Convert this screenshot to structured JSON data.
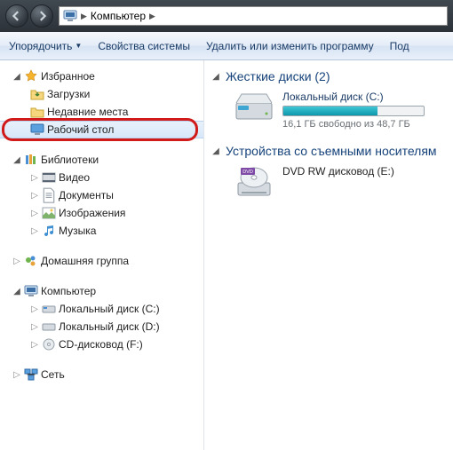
{
  "breadcrumb": {
    "root": "Компьютер"
  },
  "toolbar": {
    "organize": "Упорядочить",
    "properties": "Свойства системы",
    "uninstall": "Удалить или изменить программу",
    "connect": "Под"
  },
  "sidebar": {
    "favorites": {
      "title": "Избранное",
      "items": [
        "Загрузки",
        "Недавние места",
        "Рабочий стол"
      ]
    },
    "libraries": {
      "title": "Библиотеки",
      "items": [
        "Видео",
        "Документы",
        "Изображения",
        "Музыка"
      ]
    },
    "homegroup": {
      "title": "Домашняя группа"
    },
    "computer": {
      "title": "Компьютер",
      "items": [
        "Локальный диск (C:)",
        "Локальный диск (D:)",
        "CD-дисковод (F:)"
      ]
    },
    "network": {
      "title": "Сеть"
    }
  },
  "content": {
    "hdd_header": "Жесткие диски (2)",
    "drive_c": {
      "name": "Локальный диск (C:)",
      "free_text": "16,1 ГБ свободно из 48,7 ГБ",
      "used_pct": 67
    },
    "removable_header": "Устройства со съемными носителям",
    "dvd": {
      "name": "DVD RW дисковод (E:)",
      "badge": "DVD"
    }
  }
}
